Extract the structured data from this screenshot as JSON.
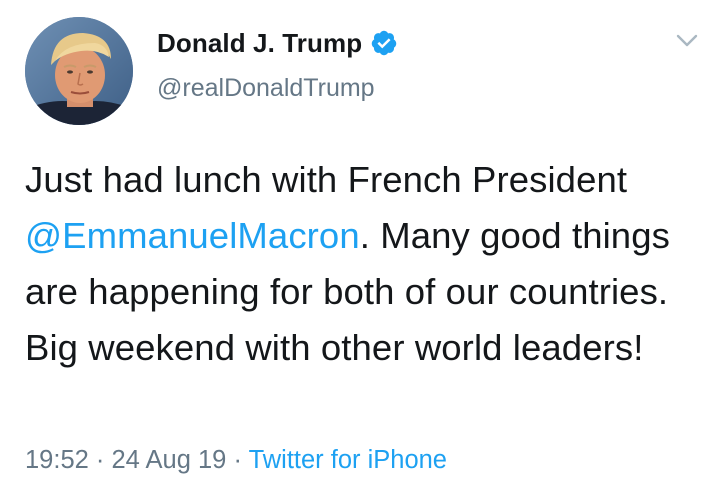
{
  "user": {
    "display_name": "Donald J. Trump",
    "handle": "@realDonaldTrump",
    "verified": true
  },
  "tweet": {
    "text_part1": "Just had lunch with French President ",
    "mention": "@EmmanuelMacron",
    "text_part2": ". Many good things are happening for both of our countries. Big weekend with other world leaders!",
    "time": "19:52",
    "separator1": " · ",
    "date": "24 Aug 19",
    "separator2": " · ",
    "source": "Twitter for iPhone"
  },
  "icons": {
    "verified": "verified-badge-icon",
    "menu": "chevron-down-icon"
  },
  "colors": {
    "text": "#14171a",
    "secondary": "#657786",
    "link": "#1da1f2"
  }
}
